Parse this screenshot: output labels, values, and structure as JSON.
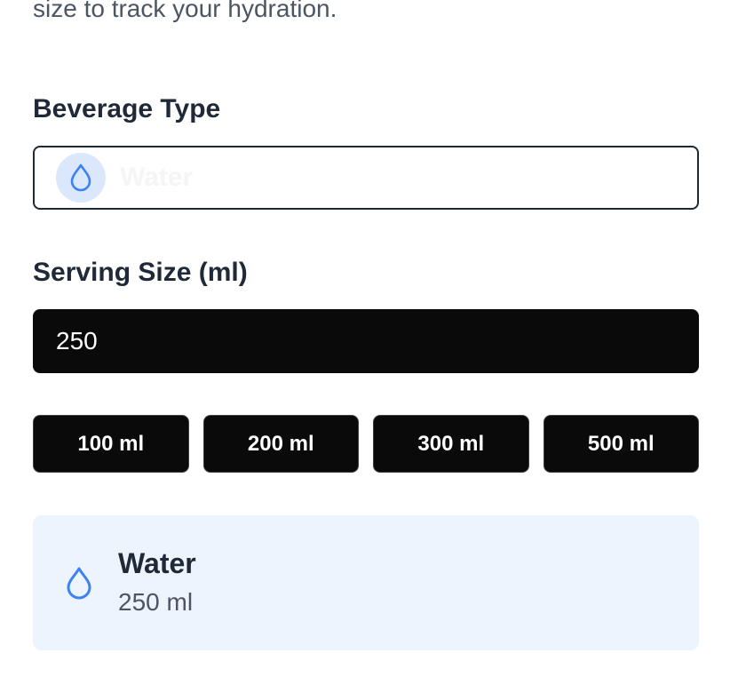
{
  "intro": {
    "text_fragment": "size to track your hydration."
  },
  "beverage": {
    "label": "Beverage Type",
    "selected": "Water",
    "icon": "droplet-icon",
    "icon_color": "#3b82f6"
  },
  "serving": {
    "label": "Serving Size (ml)",
    "value": "250"
  },
  "quick_sizes": [
    {
      "label": "100 ml"
    },
    {
      "label": "200 ml"
    },
    {
      "label": "300 ml"
    },
    {
      "label": "500 ml"
    }
  ],
  "summary": {
    "title": "Water",
    "amount": "250 ml",
    "icon": "droplet-icon",
    "background": "#eef4fd"
  }
}
